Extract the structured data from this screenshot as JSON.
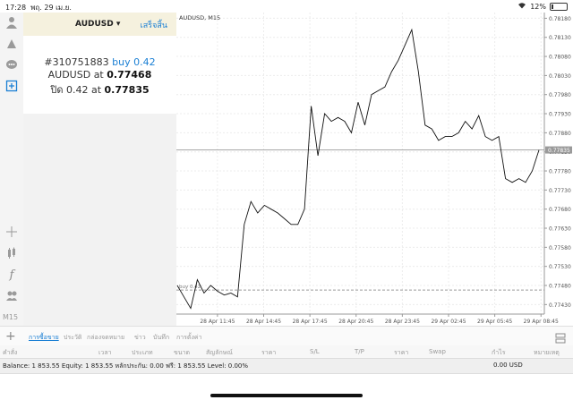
{
  "status": {
    "time": "17:28",
    "date": "พฤ. 29 เม.ย.",
    "battery": "12%"
  },
  "order_panel": {
    "symbol": "AUDUSD",
    "done_label": "เสร็จสิ้น",
    "ticket": "#310751883",
    "direction": "buy 0.42",
    "open_symbol": "AUDUSD at",
    "open_price": "0.77468",
    "close_prefix": "ปิด 0.42 at",
    "close_price": "0.77835"
  },
  "toolbar": {
    "icons": [
      "account-icon",
      "trade-signal-icon",
      "chat-icon",
      "new-order-icon",
      "crosshair-icon",
      "indicators-icon",
      "function-icon",
      "objects-icon"
    ],
    "timeframe": "M15"
  },
  "chart_data": {
    "type": "line",
    "title": "AUDUSD, M15",
    "x_labels": [
      "28 Apr 11:45",
      "28 Apr 14:45",
      "28 Apr 17:45",
      "28 Apr 20:45",
      "28 Apr 23:45",
      "29 Apr 02:45",
      "29 Apr 05:45",
      "29 Apr 08:45"
    ],
    "y_ticks": [
      "0.78180",
      "0.78130",
      "0.78080",
      "0.78030",
      "0.77980",
      "0.77930",
      "0.77880",
      "0.77830",
      "0.77780",
      "0.77730",
      "0.77680",
      "0.77630",
      "0.77580",
      "0.77530",
      "0.77480",
      "0.77430"
    ],
    "ylim": [
      0.77405,
      0.78195
    ],
    "values": [
      0.7748,
      0.7745,
      0.7742,
      0.77495,
      0.7746,
      0.7748,
      0.77465,
      0.77455,
      0.7746,
      0.7745,
      0.7764,
      0.777,
      0.7767,
      0.7769,
      0.7768,
      0.7767,
      0.77655,
      0.7764,
      0.7764,
      0.7768,
      0.7795,
      0.7782,
      0.7793,
      0.7791,
      0.7792,
      0.7791,
      0.7788,
      0.7796,
      0.779,
      0.7798,
      0.7799,
      0.78,
      0.7804,
      0.7807,
      0.7811,
      0.7815,
      0.7804,
      0.779,
      0.7789,
      0.7786,
      0.7787,
      0.7787,
      0.7788,
      0.7791,
      0.7789,
      0.77925,
      0.7787,
      0.7786,
      0.7787,
      0.7776,
      0.7775,
      0.7776,
      0.7775,
      0.7778,
      0.77835
    ],
    "current_price": "0.77835",
    "open_price_line": 0.77468,
    "open_line_label": "buy 0.42",
    "grid": true
  },
  "bottom_tabs": [
    "การซื้อขาย",
    "ประวัติ",
    "กล่องจดหมาย",
    "ข่าว",
    "บันทึก",
    "การตั้งค่า"
  ],
  "columns": [
    "คำสั่ง",
    "เวลา",
    "ประเภท",
    "ขนาด",
    "สัญลักษณ์",
    "ราคา",
    "S/L",
    "T/P",
    "ราคา",
    "Swap",
    "กำไร",
    "หมายเหตุ"
  ],
  "balance": {
    "text": "Balance: 1 853.55 Equity: 1 853.55 หลักประกัน: 0.00 ฟรี: 1 853.55 Level: 0.00%",
    "pl": "0.00  USD"
  }
}
